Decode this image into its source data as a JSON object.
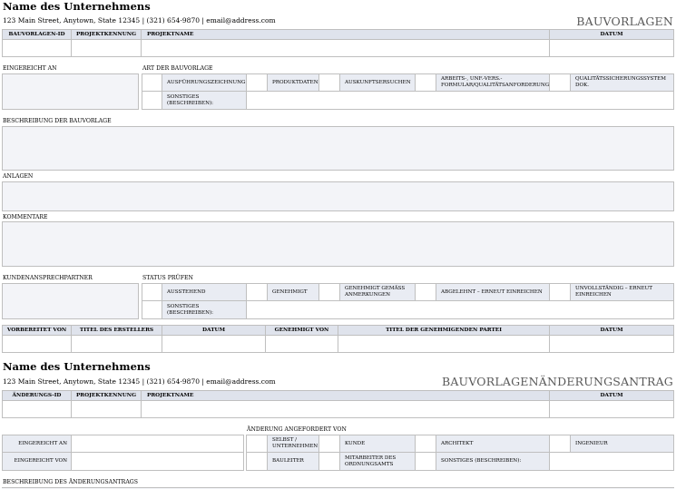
{
  "form1": {
    "company": "Name des Unternehmens",
    "address": "123 Main Street, Anytown, State 12345 | (321) 654-9870 | email@address.com",
    "title": "BAUVORLAGEN",
    "header_cols": [
      "BAUVORLAGEN-ID",
      "PROJEKTKENNUNG",
      "PROJEKTNAME",
      "DATUM"
    ],
    "submitted_label": "EINGEREICHT AN",
    "type_label": "ART DER BAUVORLAGE",
    "type_options": [
      "AUSFÜHRUNGSZEICHNUNG",
      "PRODUKTDATEN",
      "AUSKUNFTSERSUCHEN",
      "ARBEITS-, UNF.-VERS.-FORMULAR/QUALITÄTSANFORDERUNG",
      "QUALITÄTSSICHERUNGSSYSTEM DOK."
    ],
    "type_other": "SONSTIGES (BESCHREIBEN):",
    "description_label": "BESCHREIBUNG DER BAUVORLAGE",
    "attachments_label": "ANLAGEN",
    "comments_label": "KOMMENTARE",
    "contact_label": "KUNDENANSPRECHPARTNER",
    "status_label": "STATUS PRÜFEN",
    "status_options": [
      "AUSSTEHEND",
      "GENEHMIGT",
      "GENEHMIGT GEMÄSS ANMERKUNGEN",
      "ABGELEHNT – ERNEUT EINREICHEN",
      "UNVOLLSTÄNDIG – ERNEUT EINREICHEN"
    ],
    "status_other": "SONSTIGES (BESCHREIBEN):",
    "sign_cols": [
      "VORBEREITET VON",
      "TITEL DES ERSTELLERS",
      "DATUM",
      "GENEHMIGT VON",
      "TITEL DER GENEHMIGENDEN PARTEI",
      "DATUM"
    ]
  },
  "form2": {
    "company": "Name des Unternehmens",
    "address": "123 Main Street, Anytown, State 12345 | (321) 654-9870 | email@address.com",
    "title": "BAUVORLAGENÄNDERUNGSANTRAG",
    "header_cols": [
      "ÄNDERUNGS-ID",
      "PROJEKTKENNUNG",
      "PROJEKTNAME",
      "DATUM"
    ],
    "requested_by_label": "ÄNDERUNG ANGEFORDERT VON",
    "submitted_label": "EINGEREICHT AN",
    "submitted_by_label": "EINGEREICHT VON",
    "requesters": [
      "SELBST / UNTERNEHMEN",
      "KUNDE",
      "ARCHITEKT",
      "INGENIEUR",
      "BAULEITER",
      "MITARBEITER DES ORDNUNGSAMTS",
      "SONSTIGES (BESCHREIBEN):"
    ],
    "description_label": "BESCHREIBUNG DES ÄNDERUNGSANTRAGS"
  }
}
